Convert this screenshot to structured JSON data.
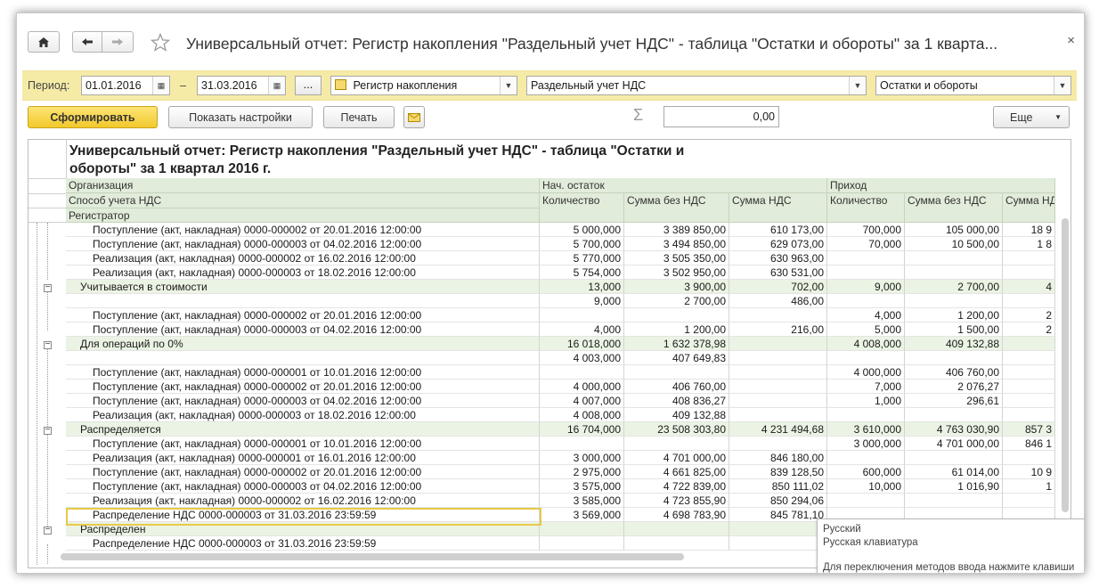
{
  "window": {
    "title": "Универсальный отчет: Регистр накопления \"Раздельный учет НДС\" - таблица \"Остатки и обороты\" за 1 кварта...",
    "close_glyph": "×"
  },
  "filters": {
    "period_label": "Период:",
    "date_from": "01.01.2016",
    "dash": "–",
    "date_to": "31.03.2016",
    "dots_label": "...",
    "object_type": "Регистр накопления",
    "object_name": "Раздельный учет НДС",
    "table_name": "Остатки и обороты"
  },
  "toolbar": {
    "generate_label": "Сформировать",
    "settings_label": "Показать настройки",
    "print_label": "Печать",
    "sum_value": "0,00",
    "more_label": "Еще"
  },
  "report": {
    "title_line1": "Универсальный отчет: Регистр накопления \"Раздельный учет НДС\" - таблица \"Остатки и",
    "title_line2": "обороты\" за 1 квартал 2016 г.",
    "headers": {
      "organization": "Организация",
      "method": "Способ учета НДС",
      "registrar": "Регистратор",
      "opening": "Нач. остаток",
      "income": "Приход",
      "qty": "Количество",
      "sum_no_vat": "Сумма без НДС",
      "vat": "Сумма НДС",
      "qty2": "Количество",
      "sum_no_vat2": "Сумма без НДС",
      "vat2": "Сумма НДС"
    },
    "rows": [
      {
        "kind": "doc",
        "name": "Поступление (акт, накладная) 0000-000002 от 20.01.2016 12:00:00",
        "c1": "5 000,000",
        "c2": "3 389 850,00",
        "c3": "610 173,00",
        "c4": "700,000",
        "c5": "105 000,00",
        "c6": "18 9"
      },
      {
        "kind": "doc",
        "name": "Поступление (акт, накладная) 0000-000003 от 04.02.2016 12:00:00",
        "c1": "5 700,000",
        "c2": "3 494 850,00",
        "c3": "629 073,00",
        "c4": "70,000",
        "c5": "10 500,00",
        "c6": "1 8"
      },
      {
        "kind": "doc",
        "name": "Реализация (акт, накладная) 0000-000002 от 16.02.2016 12:00:00",
        "c1": "5 770,000",
        "c2": "3 505 350,00",
        "c3": "630 963,00",
        "c4": "",
        "c5": "",
        "c6": ""
      },
      {
        "kind": "doc",
        "name": "Реализация (акт, накладная) 0000-000003 от 18.02.2016 12:00:00",
        "c1": "5 754,000",
        "c2": "3 502 950,00",
        "c3": "630 531,00",
        "c4": "",
        "c5": "",
        "c6": ""
      },
      {
        "kind": "grp",
        "name": "Учитывается в стоимости",
        "c1": "13,000",
        "c2": "3 900,00",
        "c3": "702,00",
        "c4": "9,000",
        "c5": "2 700,00",
        "c6": "4"
      },
      {
        "kind": "sub",
        "name": "",
        "c1": "9,000",
        "c2": "2 700,00",
        "c3": "486,00",
        "c4": "",
        "c5": "",
        "c6": ""
      },
      {
        "kind": "doc",
        "name": "Поступление (акт, накладная) 0000-000002 от 20.01.2016 12:00:00",
        "c1": "",
        "c2": "",
        "c3": "",
        "c4": "4,000",
        "c5": "1 200,00",
        "c6": "2"
      },
      {
        "kind": "doc",
        "name": "Поступление (акт, накладная) 0000-000003 от 04.02.2016 12:00:00",
        "c1": "4,000",
        "c2": "1 200,00",
        "c3": "216,00",
        "c4": "5,000",
        "c5": "1 500,00",
        "c6": "2"
      },
      {
        "kind": "grp",
        "name": "Для операций по 0%",
        "c1": "16 018,000",
        "c2": "1 632 378,98",
        "c3": "",
        "c4": "4 008,000",
        "c5": "409 132,88",
        "c6": ""
      },
      {
        "kind": "sub",
        "name": "",
        "c1": "4 003,000",
        "c2": "407 649,83",
        "c3": "",
        "c4": "",
        "c5": "",
        "c6": ""
      },
      {
        "kind": "doc",
        "name": "Поступление (акт, накладная) 0000-000001 от 10.01.2016 12:00:00",
        "c1": "",
        "c2": "",
        "c3": "",
        "c4": "4 000,000",
        "c5": "406 760,00",
        "c6": ""
      },
      {
        "kind": "doc",
        "name": "Поступление (акт, накладная) 0000-000002 от 20.01.2016 12:00:00",
        "c1": "4 000,000",
        "c2": "406 760,00",
        "c3": "",
        "c4": "7,000",
        "c5": "2 076,27",
        "c6": ""
      },
      {
        "kind": "doc",
        "name": "Поступление (акт, накладная) 0000-000003 от 04.02.2016 12:00:00",
        "c1": "4 007,000",
        "c2": "408 836,27",
        "c3": "",
        "c4": "1,000",
        "c5": "296,61",
        "c6": ""
      },
      {
        "kind": "doc",
        "name": "Реализация (акт, накладная) 0000-000003 от 18.02.2016 12:00:00",
        "c1": "4 008,000",
        "c2": "409 132,88",
        "c3": "",
        "c4": "",
        "c5": "",
        "c6": ""
      },
      {
        "kind": "grp",
        "name": "Распределяется",
        "c1": "16 704,000",
        "c2": "23 508 303,80",
        "c3": "4 231 494,68",
        "c4": "3 610,000",
        "c5": "4 763 030,90",
        "c6": "857 3"
      },
      {
        "kind": "doc",
        "name": "Поступление (акт, накладная) 0000-000001 от 10.01.2016 12:00:00",
        "c1": "",
        "c2": "",
        "c3": "",
        "c4": "3 000,000",
        "c5": "4 701 000,00",
        "c6": "846 1"
      },
      {
        "kind": "doc",
        "name": "Реализация (акт, накладная) 0000-000001 от 16.01.2016 12:00:00",
        "c1": "3 000,000",
        "c2": "4 701 000,00",
        "c3": "846 180,00",
        "c4": "",
        "c5": "",
        "c6": ""
      },
      {
        "kind": "doc",
        "name": "Поступление (акт, накладная) 0000-000002 от 20.01.2016 12:00:00",
        "c1": "2 975,000",
        "c2": "4 661 825,00",
        "c3": "839 128,50",
        "c4": "600,000",
        "c5": "61 014,00",
        "c6": "10 9"
      },
      {
        "kind": "doc",
        "name": "Поступление (акт, накладная) 0000-000003 от 04.02.2016 12:00:00",
        "c1": "3 575,000",
        "c2": "4 722 839,00",
        "c3": "850 111,02",
        "c4": "10,000",
        "c5": "1 016,90",
        "c6": "1"
      },
      {
        "kind": "doc",
        "name": "Реализация (акт, накладная) 0000-000002 от 16.02.2016 12:00:00",
        "c1": "3 585,000",
        "c2": "4 723 855,90",
        "c3": "850 294,06",
        "c4": "",
        "c5": "",
        "c6": ""
      },
      {
        "kind": "doc",
        "name": "Распределение НДС 0000-000003 от 31.03.2016 23:59:59",
        "c1": "3 569,000",
        "c2": "4 698 783,90",
        "c3": "845 781,10",
        "c4": "",
        "c5": "",
        "c6": ""
      },
      {
        "kind": "grp",
        "name": "Распределен",
        "c1": "",
        "c2": "",
        "c3": "",
        "c4": "",
        "c5": "",
        "c6": ""
      },
      {
        "kind": "doc",
        "name": "Распределение НДС 0000-000003 от 31.03.2016 23:59:59",
        "c1": "",
        "c2": "",
        "c3": "",
        "c4": "",
        "c5": "",
        "c6": ""
      }
    ]
  },
  "tooltip": {
    "language": "Русский",
    "keyboard": "Русская клавиатура",
    "hint": "Для переключения методов ввода нажмите клавиши"
  },
  "icons": {
    "home": "home-icon",
    "back": "arrow-left-icon",
    "forward": "arrow-right-icon",
    "favorite": "star-icon",
    "calendar": "calendar-icon",
    "sum": "sigma-icon",
    "mail": "envelope-icon"
  },
  "colors": {
    "accent": "#f2c92c",
    "filter_bg": "#f6eba6",
    "header_bg": "#e1ecda",
    "group_bg": "#ebf4e4"
  }
}
